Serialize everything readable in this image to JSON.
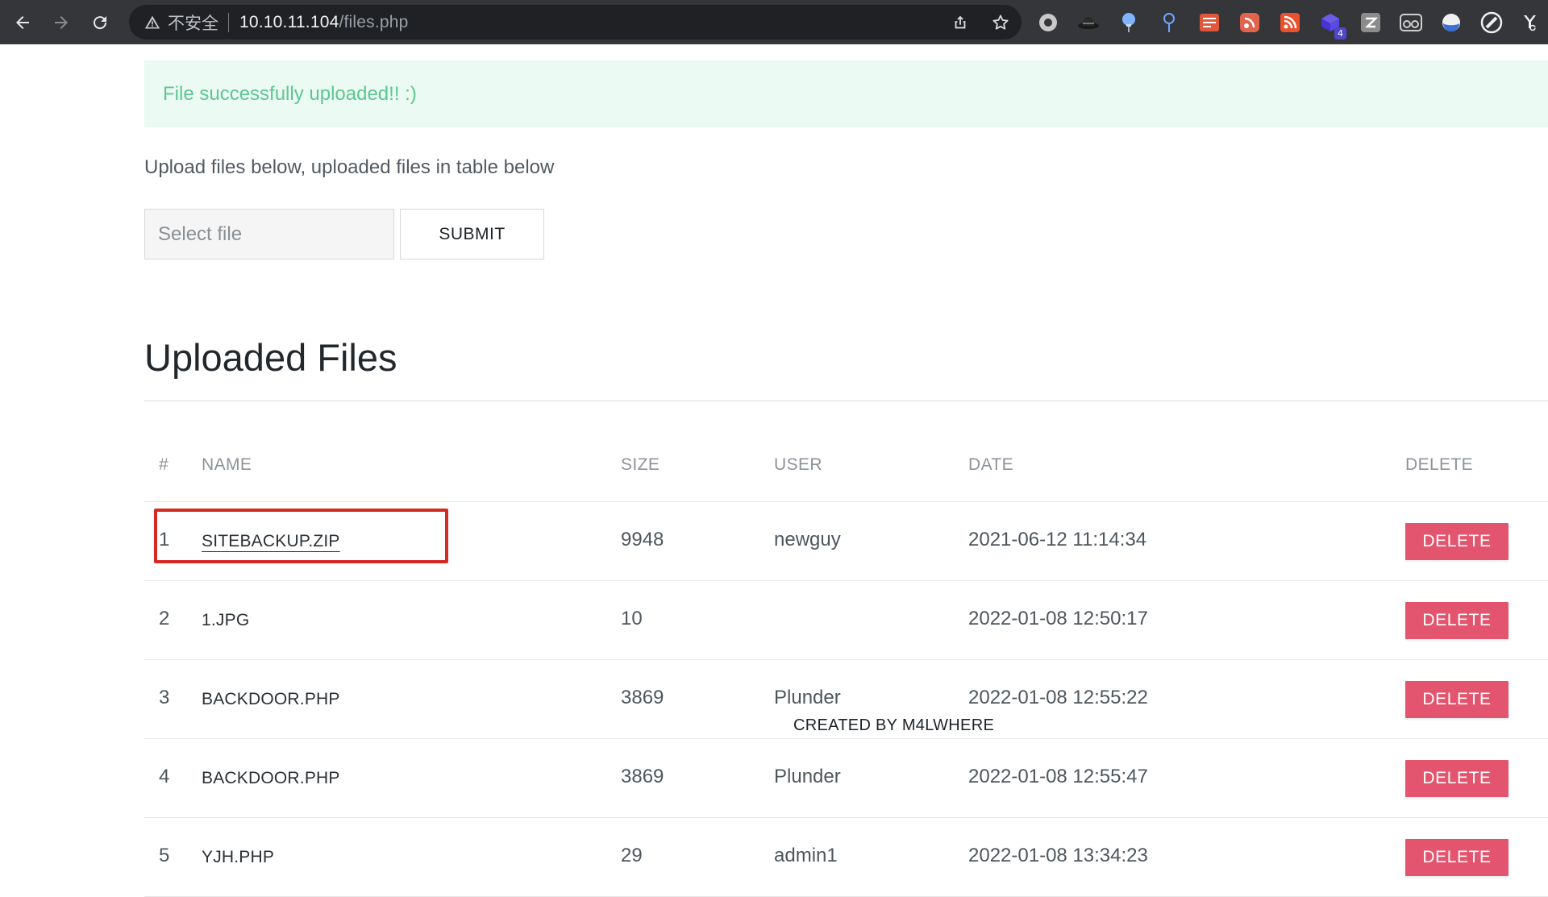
{
  "browser": {
    "security_label": "不安全",
    "url_host": "10.10.11.104",
    "url_path": "/files.php",
    "extensions": [
      {
        "icon": "record-circle-icon"
      },
      {
        "icon": "hat-icon"
      },
      {
        "icon": "balloon-icon"
      },
      {
        "icon": "pin-icon"
      },
      {
        "icon": "notes-list-icon"
      },
      {
        "icon": "rss-circle-icon"
      },
      {
        "icon": "rss-icon"
      },
      {
        "icon": "cube-icon",
        "badge": "4"
      },
      {
        "icon": "zotero-icon"
      },
      {
        "icon": "glasses-icon"
      },
      {
        "icon": "half-moon-icon"
      },
      {
        "icon": "compass-slash-icon"
      },
      {
        "icon": "yc-icon"
      }
    ]
  },
  "alert": {
    "message": "File successfully uploaded!! :)"
  },
  "upload": {
    "instructions": "Upload files below, uploaded files in table below",
    "file_placeholder": "Select file",
    "submit_label": "SUBMIT"
  },
  "files_section": {
    "title": "Uploaded Files",
    "columns": {
      "num": "#",
      "name": "NAME",
      "size": "SIZE",
      "user": "USER",
      "date": "DATE",
      "delete": "DELETE"
    },
    "rows": [
      {
        "num": "1",
        "name": "SITEBACKUP.ZIP",
        "size": "9948",
        "user": "newguy",
        "date": "2021-06-12 11:14:34",
        "delete_label": "DELETE"
      },
      {
        "num": "2",
        "name": "1.JPG",
        "size": "10",
        "user": "",
        "date": "2022-01-08 12:50:17",
        "delete_label": "DELETE"
      },
      {
        "num": "3",
        "name": "BACKDOOR.PHP",
        "size": "3869",
        "user": "Plunder",
        "date": "2022-01-08 12:55:22",
        "delete_label": "DELETE"
      },
      {
        "num": "4",
        "name": "BACKDOOR.PHP",
        "size": "3869",
        "user": "Plunder",
        "date": "2022-01-08 12:55:47",
        "delete_label": "DELETE"
      },
      {
        "num": "5",
        "name": "YJH.PHP",
        "size": "29",
        "user": "admin1",
        "date": "2022-01-08 13:34:23",
        "delete_label": "DELETE"
      }
    ]
  },
  "watermark": "CREATED BY M4LWHERE",
  "colors": {
    "alert_bg": "#ebfaf2",
    "alert_text": "#5cc791",
    "delete_button": "#e3546e",
    "highlight_box": "#d42a22",
    "browser_toolbar": "#35363a",
    "omnibox": "#202124"
  }
}
